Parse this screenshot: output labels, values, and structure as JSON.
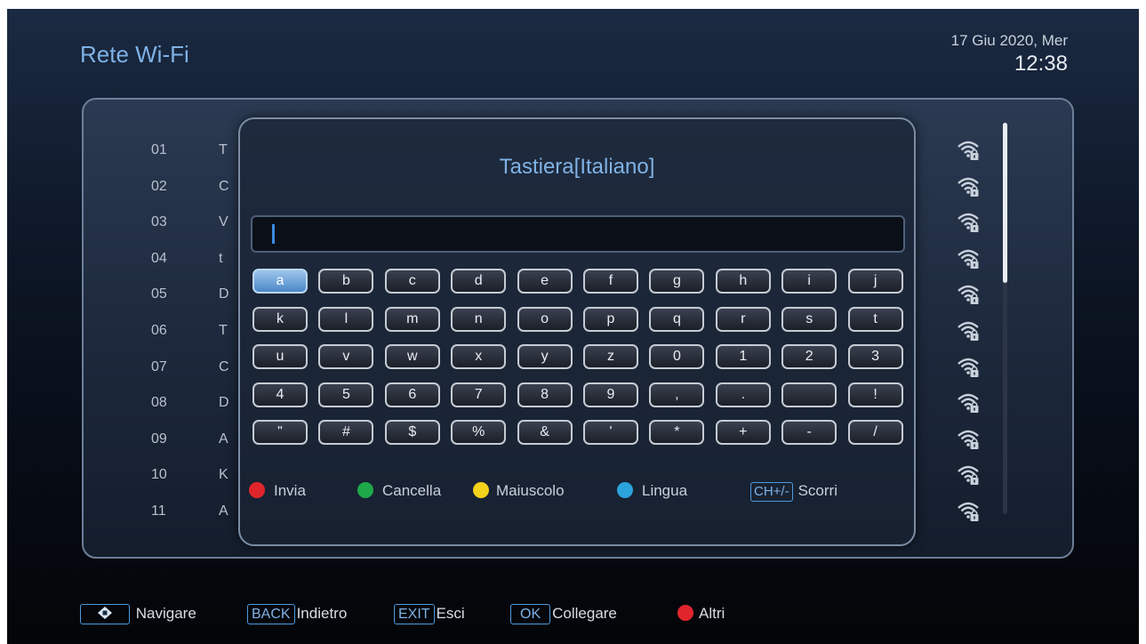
{
  "header": {
    "title": "Rete Wi-Fi",
    "date": "17 Giu 2020, Mer",
    "time": "12:38"
  },
  "network_list": {
    "rows": [
      {
        "num": "01",
        "name": "T",
        "signal_icon": "wifi-locked-icon"
      },
      {
        "num": "02",
        "name": "C",
        "signal_icon": "wifi-locked-icon"
      },
      {
        "num": "03",
        "name": "V",
        "signal_icon": "wifi-locked-icon"
      },
      {
        "num": "04",
        "name": "t",
        "signal_icon": "wifi-locked-icon"
      },
      {
        "num": "05",
        "name": "D",
        "signal_icon": "wifi-locked-icon"
      },
      {
        "num": "06",
        "name": "T",
        "signal_icon": "wifi-locked-icon"
      },
      {
        "num": "07",
        "name": "C",
        "signal_icon": "wifi-locked-icon"
      },
      {
        "num": "08",
        "name": "D",
        "signal_icon": "wifi-locked-icon"
      },
      {
        "num": "09",
        "name": "A",
        "signal_icon": "wifi-locked-icon"
      },
      {
        "num": "10",
        "name": "K",
        "signal_icon": "wifi-locked-icon"
      },
      {
        "num": "11",
        "name": "A",
        "signal_icon": "wifi-locked-icon"
      }
    ]
  },
  "keyboard": {
    "title": "Tastiera[Italiano]",
    "input_value": "",
    "selected_key": "a",
    "keys": [
      [
        "a",
        "b",
        "c",
        "d",
        "e",
        "f",
        "g",
        "h",
        "i",
        "j"
      ],
      [
        "k",
        "l",
        "m",
        "n",
        "o",
        "p",
        "q",
        "r",
        "s",
        "t"
      ],
      [
        "u",
        "v",
        "w",
        "x",
        "y",
        "z",
        "0",
        "1",
        "2",
        "3"
      ],
      [
        "4",
        "5",
        "6",
        "7",
        "8",
        "9",
        ",",
        ".",
        " ",
        "!"
      ],
      [
        "\"",
        "#",
        "$",
        "%",
        "&",
        "'",
        "*",
        "+",
        "-",
        "/"
      ]
    ],
    "legend": {
      "send": "Invia",
      "delete": "Cancella",
      "uppercase": "Maiuscolo",
      "language": "Lingua",
      "scroll_key": "CH+/-",
      "scroll": "Scorri"
    }
  },
  "help_bar": {
    "navigate": "Navigare",
    "back_key": "BACK",
    "back": "Indietro",
    "exit_key": "EXIT",
    "exit": "Esci",
    "ok_key": "OK",
    "connect": "Collegare",
    "more": "Altri"
  },
  "colors": {
    "accent_blue": "#7fb2e6",
    "red": "#e0262c",
    "green": "#1fa84a",
    "yellow": "#f3d21b",
    "blue": "#2ba3dc"
  }
}
